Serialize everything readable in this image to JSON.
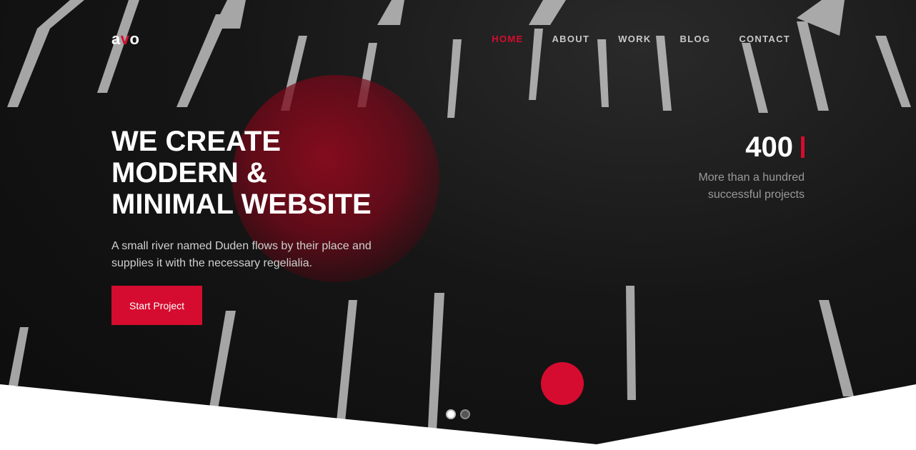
{
  "logo": {
    "a": "a",
    "v": "v",
    "o": "o"
  },
  "nav": {
    "items": [
      "HOME",
      "ABOUT",
      "WORK",
      "BLOG",
      "CONTACT"
    ],
    "active": "HOME"
  },
  "hero": {
    "headline_line1": "WE CREATE",
    "headline_line2": "MODERN &",
    "headline_line3": "MINIMAL WEBSITE",
    "subtext": "A small river named Duden flows by their place and supplies it with the necessary regelialia.",
    "cta_label": "Start Project"
  },
  "stat": {
    "number": "400",
    "label": "More than a hundred successful projects"
  },
  "slider": {
    "slides": 2,
    "active": 1
  },
  "colors": {
    "accent": "#d50c2f",
    "dark": "#111111",
    "white": "#ffffff"
  }
}
